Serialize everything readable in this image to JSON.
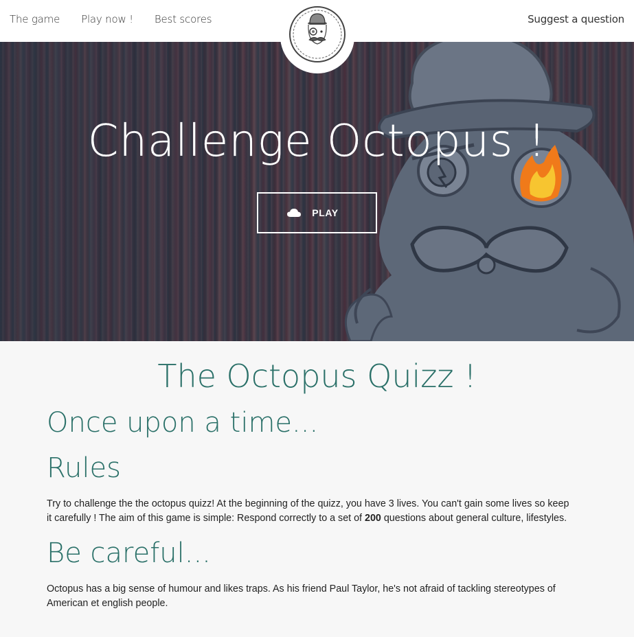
{
  "nav": {
    "links": [
      "The game",
      "Play now !",
      "Best scores"
    ],
    "right_link": "Suggest a question",
    "logo_icon": "octopus-bowler-hat-logo"
  },
  "hero": {
    "title": "Challenge Octopus !",
    "play_button": "PLAY",
    "play_icon": "cloud-icon"
  },
  "main": {
    "heading": "The Octopus Quizz !",
    "section1_title": "Once upon a time...",
    "section2_title": "Rules",
    "rules_text_before": "Try to challenge the the octopus quizz! At the beginning of the quizz, you have 3 lives. You can't gain some lives so keep it carefully ! The aim of this game is simple: Respond correctly to a set of ",
    "rules_count": "200",
    "rules_text_after": " questions about general culture, lifestyles.",
    "section3_title": "Be careful...",
    "careful_text": "Octopus has a big sense of humour and likes traps. As his friend Paul Taylor, he's not afraid of tackling stereotypes of American et english people."
  },
  "colors": {
    "accent": "#2a7068",
    "navbar_bg": "#ffffff",
    "content_bg": "#f7f7f7"
  }
}
